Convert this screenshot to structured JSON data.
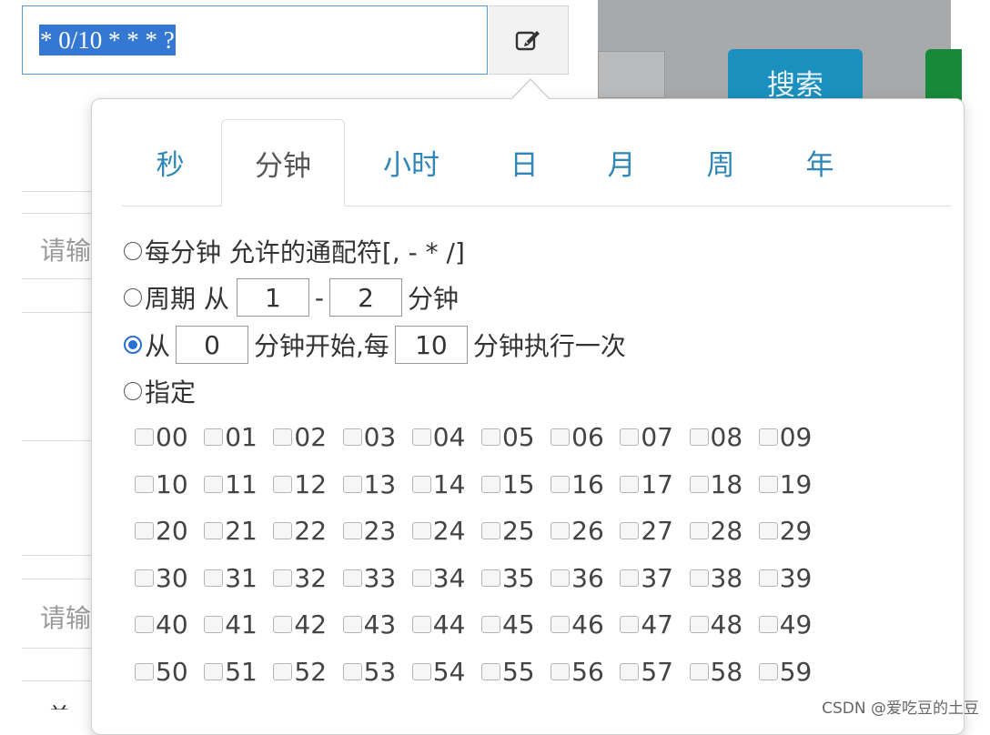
{
  "cron_field": {
    "value": "* 0/10 * * * ?",
    "edit_icon": "edit-icon"
  },
  "background": {
    "search_label": "搜索",
    "placeholder_1": "请输",
    "placeholder_2": "请输",
    "bottom_text": "单执"
  },
  "tabs": [
    {
      "label": "秒"
    },
    {
      "label": "分钟"
    },
    {
      "label": "小时"
    },
    {
      "label": "日"
    },
    {
      "label": "月"
    },
    {
      "label": "周"
    },
    {
      "label": "年"
    }
  ],
  "active_tab": "分钟",
  "options": {
    "every": {
      "label": "每分钟 允许的通配符[, - * /]"
    },
    "period": {
      "prefix": "周期 从",
      "from": "1",
      "dash": "-",
      "to": "2",
      "suffix": "分钟"
    },
    "interval": {
      "prefix": "从",
      "start": "0",
      "middle": "分钟开始,每",
      "step": "10",
      "suffix": "分钟执行一次"
    },
    "specific": {
      "label": "指定"
    }
  },
  "selected_option": "interval",
  "minute_values": [
    [
      "00",
      "01",
      "02",
      "03",
      "04",
      "05",
      "06",
      "07",
      "08",
      "09"
    ],
    [
      "10",
      "11",
      "12",
      "13",
      "14",
      "15",
      "16",
      "17",
      "18",
      "19"
    ],
    [
      "20",
      "21",
      "22",
      "23",
      "24",
      "25",
      "26",
      "27",
      "28",
      "29"
    ],
    [
      "30",
      "31",
      "32",
      "33",
      "34",
      "35",
      "36",
      "37",
      "38",
      "39"
    ],
    [
      "40",
      "41",
      "42",
      "43",
      "44",
      "45",
      "46",
      "47",
      "48",
      "49"
    ],
    [
      "50",
      "51",
      "52",
      "53",
      "54",
      "55",
      "56",
      "57",
      "58",
      "59"
    ]
  ],
  "watermark": "CSDN @爱吃豆的土豆",
  "colors": {
    "accent": "#2f86b9",
    "selection": "#3478d4",
    "search_button": "#1b8fbd",
    "radio_checked": "#2a6fd6"
  }
}
